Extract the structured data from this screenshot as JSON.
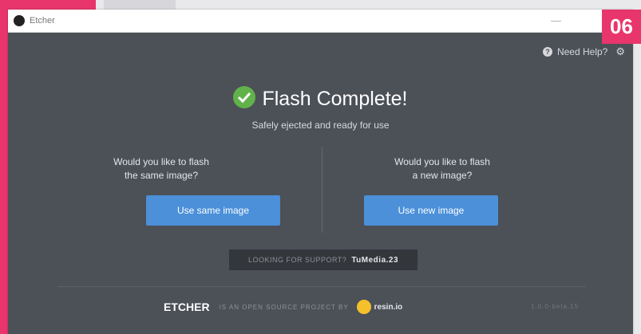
{
  "window": {
    "title": "Etcher"
  },
  "badge": "06",
  "help": {
    "label": "Need Help?"
  },
  "status": {
    "title": "Flash Complete!",
    "subtitle": "Safely ejected and ready for use"
  },
  "left": {
    "prompt_line1": "Would you like to flash",
    "prompt_line2": "the same image?",
    "button": "Use same image"
  },
  "right": {
    "prompt_line1": "Would you like to flash",
    "prompt_line2": "a new image?",
    "button": "Use new image"
  },
  "support": {
    "text": "LOOKING FOR SUPPORT?",
    "link": "TuMedia.23"
  },
  "footer": {
    "brand": "ETCHER",
    "tagline": "IS AN OPEN SOURCE PROJECT BY",
    "company": "resin.io",
    "version": "1.0.0-beta.15"
  },
  "colors": {
    "accent": "#4b90d9",
    "success": "#61b24b",
    "badge": "#e8356b",
    "background": "#4c5057"
  }
}
